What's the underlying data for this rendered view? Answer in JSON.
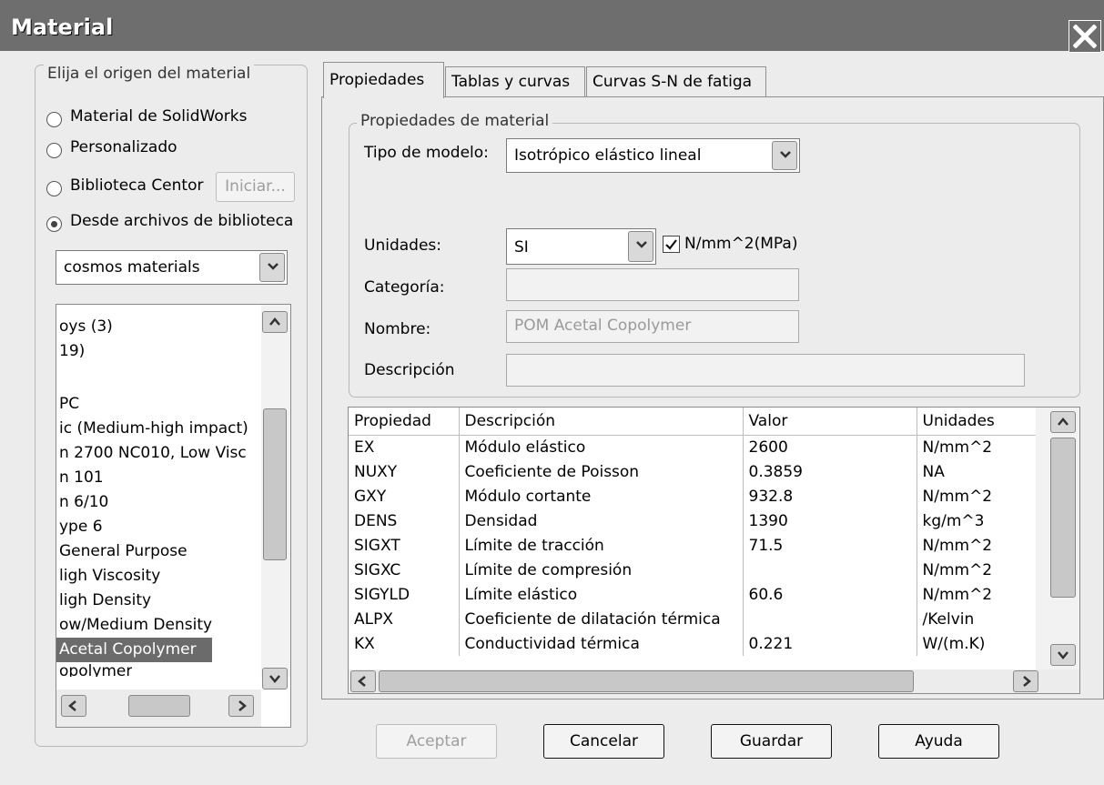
{
  "window": {
    "title": "Material",
    "close_icon": "close-icon"
  },
  "source_group": {
    "legend": "Elija el origen del material",
    "options": [
      {
        "label": "Material de SolidWorks",
        "selected": false
      },
      {
        "label": "Personalizado",
        "selected": false
      },
      {
        "label": "Biblioteca Centor",
        "selected": false
      },
      {
        "label": "Desde archivos de biblioteca",
        "selected": true
      }
    ],
    "start_button": "Iniciar...",
    "library_combo": "cosmos materials",
    "list_items": [
      "oys (3)",
      "19)",
      "",
      "PC",
      "ic (Medium-high impact)",
      "n 2700 NC010, Low Visc",
      "n 101",
      "n 6/10",
      "ype 6",
      " General Purpose",
      "ligh Viscosity",
      "ligh Density",
      "ow/Medium Density",
      " Acetal Copolymer",
      "opolymer"
    ],
    "selected_index": 13
  },
  "tabs": [
    {
      "label": "Propiedades",
      "active": true
    },
    {
      "label": "Tablas y curvas",
      "active": false
    },
    {
      "label": "Curvas S-N de fatiga",
      "active": false
    }
  ],
  "properties_group": {
    "legend": "Propiedades de material",
    "model_type_label": "Tipo de modelo:",
    "model_type_value": "Isotrópico elástico lineal",
    "units_label": "Unidades:",
    "units_value": "SI",
    "units_checkbox_label": "N/mm^2(MPa)",
    "units_checkbox_checked": true,
    "category_label": "Categoría:",
    "category_value": "",
    "name_label": "Nombre:",
    "name_value": "POM Acetal Copolymer",
    "description_label": "Descripción",
    "description_value": ""
  },
  "table": {
    "headers": [
      "Propiedad",
      "Descripción",
      "Valor",
      "Unidades"
    ],
    "rows": [
      [
        "EX",
        "Módulo elástico",
        "2600",
        "N/mm^2"
      ],
      [
        "NUXY",
        "Coeficiente de Poisson",
        "0.3859",
        "NA"
      ],
      [
        "GXY",
        "Módulo cortante",
        "932.8",
        "N/mm^2"
      ],
      [
        "DENS",
        "Densidad",
        "1390",
        "kg/m^3"
      ],
      [
        "SIGXT",
        "Límite de tracción",
        "71.5",
        "N/mm^2"
      ],
      [
        "SIGXC",
        "Límite de compresión",
        "",
        "N/mm^2"
      ],
      [
        "SIGYLD",
        "Límite elástico",
        "60.6",
        "N/mm^2"
      ],
      [
        "ALPX",
        "Coeficiente de dilatación térmica",
        "",
        "/Kelvin"
      ],
      [
        "KX",
        "Conductividad térmica",
        "0.221",
        "W/(m.K)"
      ]
    ]
  },
  "buttons": {
    "accept": "Aceptar",
    "cancel": "Cancelar",
    "save": "Guardar",
    "help": "Ayuda"
  }
}
